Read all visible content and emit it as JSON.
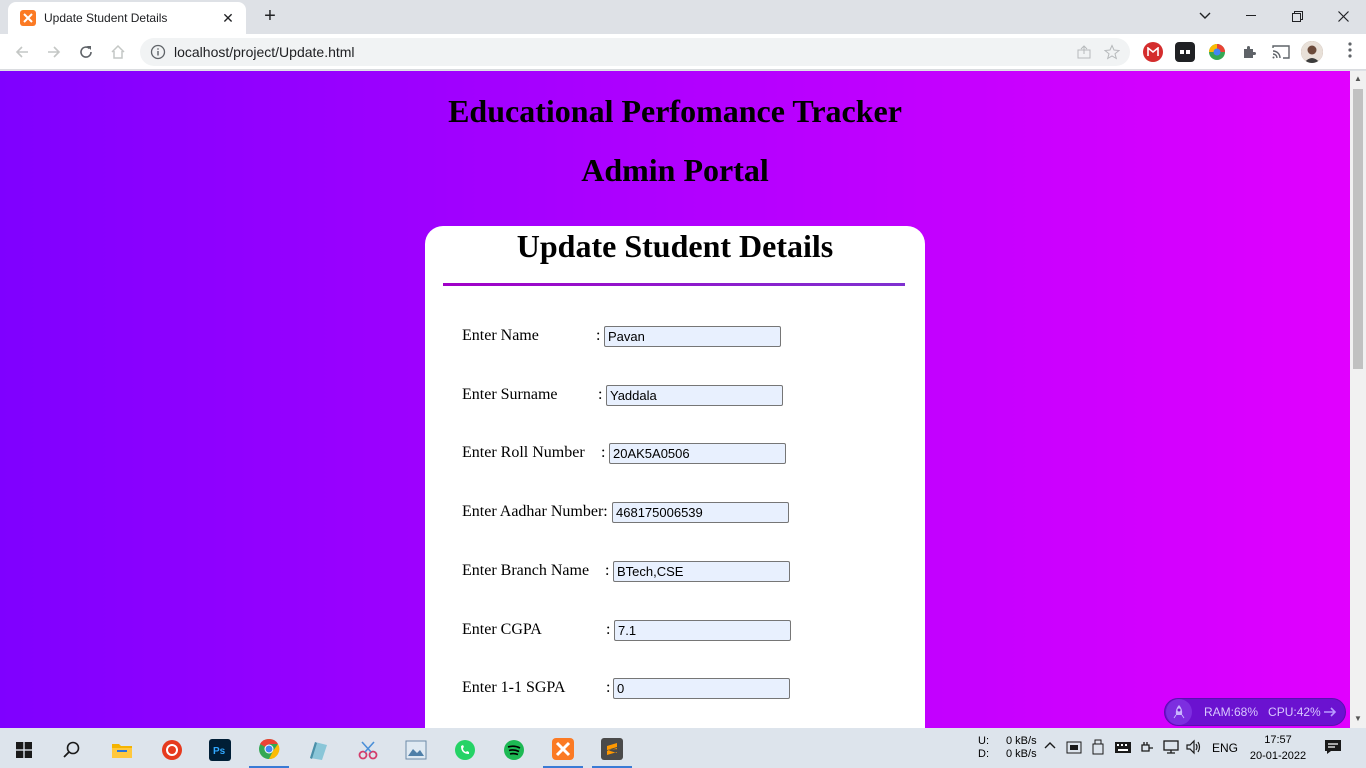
{
  "browser": {
    "tab_title": "Update Student Details",
    "url": "localhost/project/Update.html"
  },
  "page": {
    "site_title": "Educational Perfomance Tracker",
    "portal_title": "Admin Portal",
    "form_title": "Update Student Details",
    "fields": [
      {
        "label": "Enter Name",
        "value": "Pavan"
      },
      {
        "label": "Enter Surname",
        "value": "Yaddala"
      },
      {
        "label": "Enter Roll Number",
        "value": "20AK5A0506"
      },
      {
        "label": "Enter Aadhar Number:",
        "value": "468175006539"
      },
      {
        "label": "Enter Branch Name",
        "value": "BTech,CSE"
      },
      {
        "label": "Enter CGPA",
        "value": "7.1"
      },
      {
        "label": "Enter 1-1 SGPA",
        "value": "0"
      }
    ],
    "colon": ":"
  },
  "resource_monitor": {
    "ram": "RAM:68%",
    "cpu": "CPU:42%"
  },
  "taskbar": {
    "net_up_label": "U:",
    "net_down_label": "D:",
    "net_up": "0 kB/s",
    "net_down": "0 kB/s",
    "language": "ENG",
    "time": "17:57",
    "date": "20-01-2022"
  },
  "colors": {
    "gradient_start": "#7f00ff",
    "gradient_end": "#e100ff"
  }
}
